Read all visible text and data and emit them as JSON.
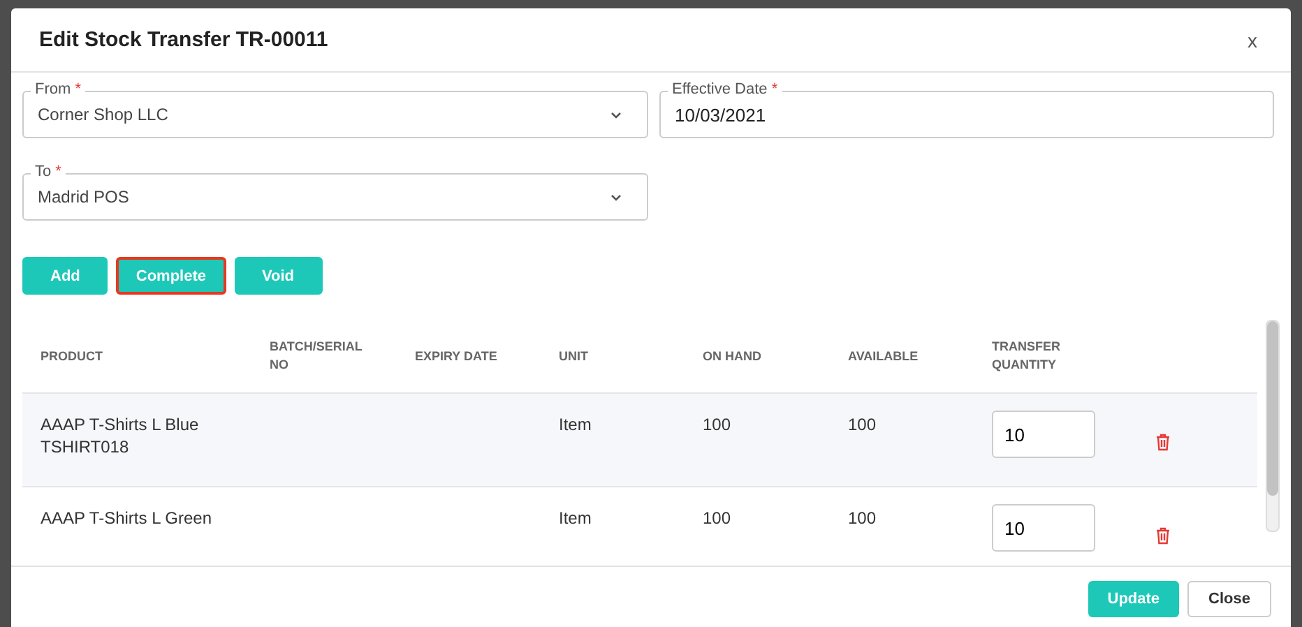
{
  "dialog": {
    "title": "Edit Stock Transfer TR-00011",
    "close": "x"
  },
  "fields": [
    {
      "kind": "select",
      "label": "From",
      "required_mark": "*",
      "value": "Corner Shop LLC"
    },
    {
      "kind": "text",
      "label": "Effective Date",
      "required_mark": "*",
      "value": "10/03/2021"
    },
    {
      "kind": "select",
      "label": "To",
      "required_mark": "*",
      "value": "Madrid POS"
    }
  ],
  "actions": [
    {
      "label": "Add",
      "focused": false
    },
    {
      "label": "Complete",
      "focused": true
    },
    {
      "label": "Void",
      "focused": false
    }
  ],
  "table": {
    "columns": [
      "PRODUCT",
      "BATCH/SERIAL NO",
      "EXPIRY DATE",
      "UNIT",
      "ON HAND",
      "AVAILABLE",
      "TRANSFER QUANTITY"
    ],
    "rows": [
      {
        "product": "AAAP T-Shirts L Blue",
        "code": "TSHIRT018",
        "unit": "Item",
        "on_hand": "100",
        "available": "100",
        "quantity": "10"
      },
      {
        "product": "AAAP T-Shirts L Green",
        "unit": "Item",
        "on_hand": "100",
        "available": "100",
        "quantity": "10"
      }
    ]
  },
  "footer": {
    "buttons": [
      {
        "label": "Update",
        "kind": "primary"
      },
      {
        "label": "Close",
        "kind": "secondary"
      }
    ]
  }
}
